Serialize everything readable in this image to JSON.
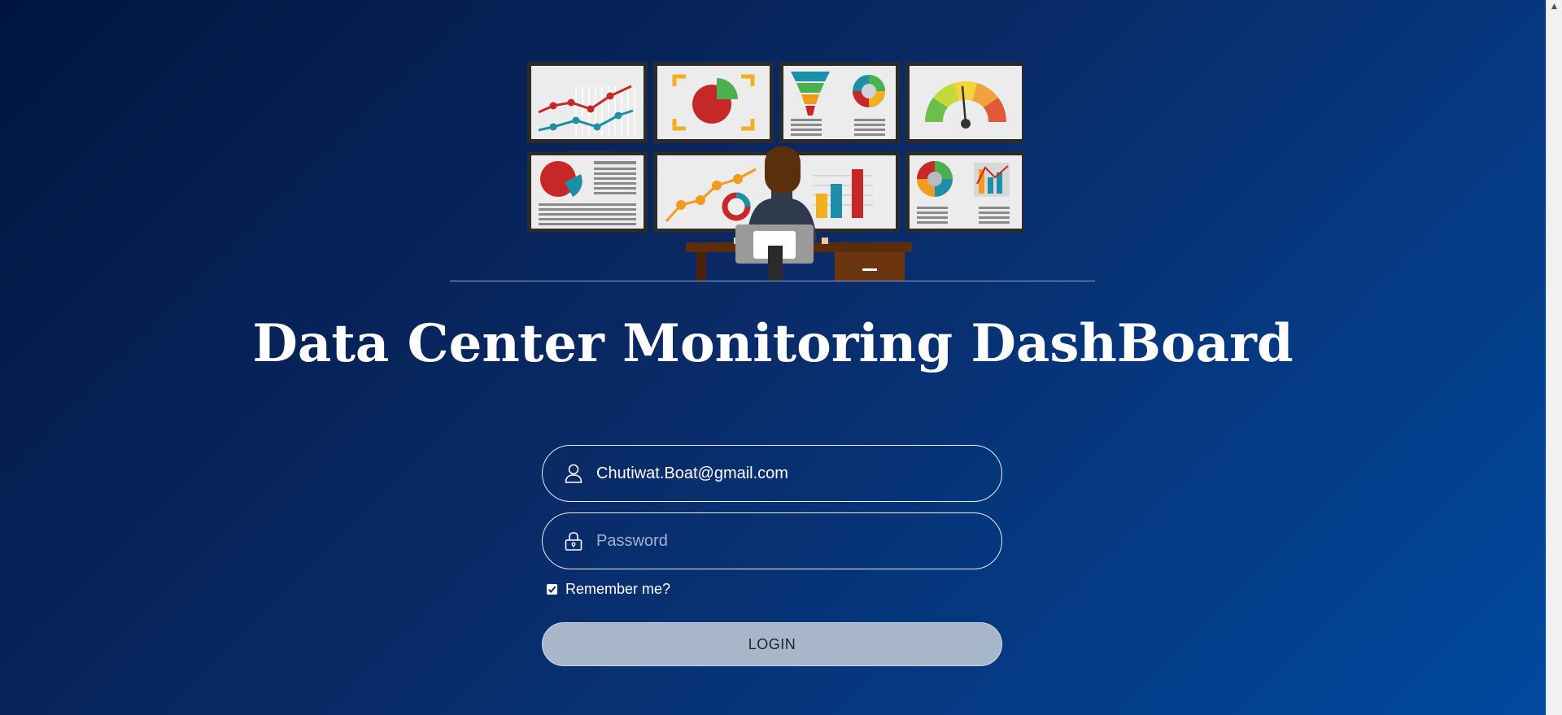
{
  "page": {
    "title": "Data Center Monitoring DashBoard"
  },
  "login": {
    "email_value": "Chutiwat.Boat@gmail.com",
    "password_placeholder": "Password",
    "remember_label": "Remember me?",
    "remember_checked": true,
    "button_label": "LOGIN"
  },
  "icons": {
    "user": "user-icon",
    "lock": "lock-icon",
    "check": "checkmark-icon",
    "scroll_up": "chevron-up-icon"
  },
  "colors": {
    "background_top": "#001640",
    "background_bottom": "#004aa0",
    "button_fill": "#a8b6ca",
    "field_border": "#e8eef8"
  }
}
